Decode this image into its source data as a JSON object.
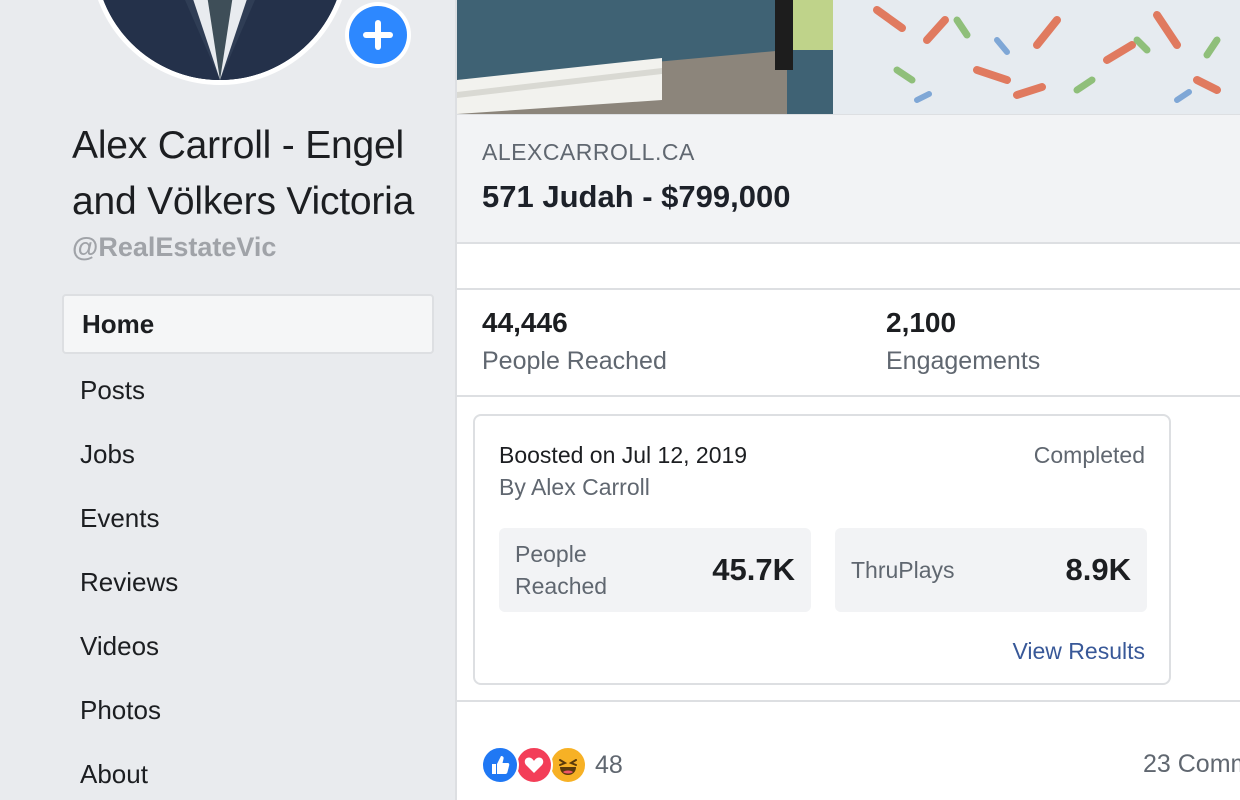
{
  "sidebar": {
    "page_name": "Alex Carroll - Engel and Völkers Victoria",
    "handle": "@RealEstateVic",
    "nav": [
      {
        "label": "Home",
        "active": true
      },
      {
        "label": "Posts"
      },
      {
        "label": "Jobs"
      },
      {
        "label": "Events"
      },
      {
        "label": "Reviews"
      },
      {
        "label": "Videos"
      },
      {
        "label": "Photos"
      },
      {
        "label": "About"
      }
    ]
  },
  "post": {
    "link_domain": "ALEXCARROLL.CA",
    "link_title": "571 Judah - $799,000",
    "stats": {
      "people_reached_value": "44,446",
      "people_reached_label": "People Reached",
      "engagements_value": "2,100",
      "engagements_label": "Engagements"
    },
    "boost": {
      "date": "Boosted on Jul 12, 2019",
      "by": "By Alex Carroll",
      "status": "Completed",
      "metric1_label": "People Reached",
      "metric1_value": "45.7K",
      "metric2_label": "ThruPlays",
      "metric2_value": "8.9K",
      "view_results": "View Results"
    },
    "reactions_count": "48",
    "comments": "23 Comm"
  },
  "colors": {
    "accent": "#2d88ff",
    "link": "#385898",
    "like": "#2078f4",
    "love": "#f33e58",
    "haha": "#f7b125"
  }
}
